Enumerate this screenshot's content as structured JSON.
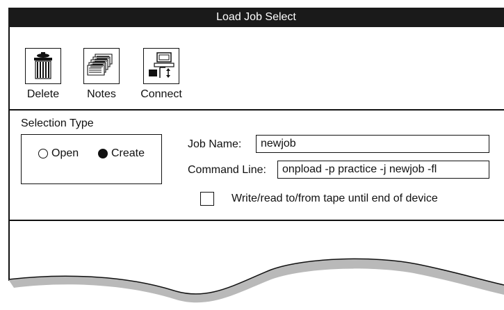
{
  "window": {
    "title": "Load Job Select"
  },
  "toolbar": {
    "delete_label": "Delete",
    "notes_label": "Notes",
    "connect_label": "Connect",
    "icons": {
      "delete": "trash-can-icon",
      "notes": "stacked-notes-icon",
      "connect": "connect-computer-icon"
    }
  },
  "selection": {
    "label": "Selection Type",
    "options": [
      {
        "label": "Open",
        "selected": false
      },
      {
        "label": "Create",
        "selected": true
      }
    ]
  },
  "job_name": {
    "label": "Job Name:",
    "value": "newjob"
  },
  "command_line": {
    "label": "Command Line:",
    "value": "onpload -p practice -j newjob -fl"
  },
  "tape_option": {
    "label": "Write/read to/from tape until end of device",
    "checked": false
  }
}
